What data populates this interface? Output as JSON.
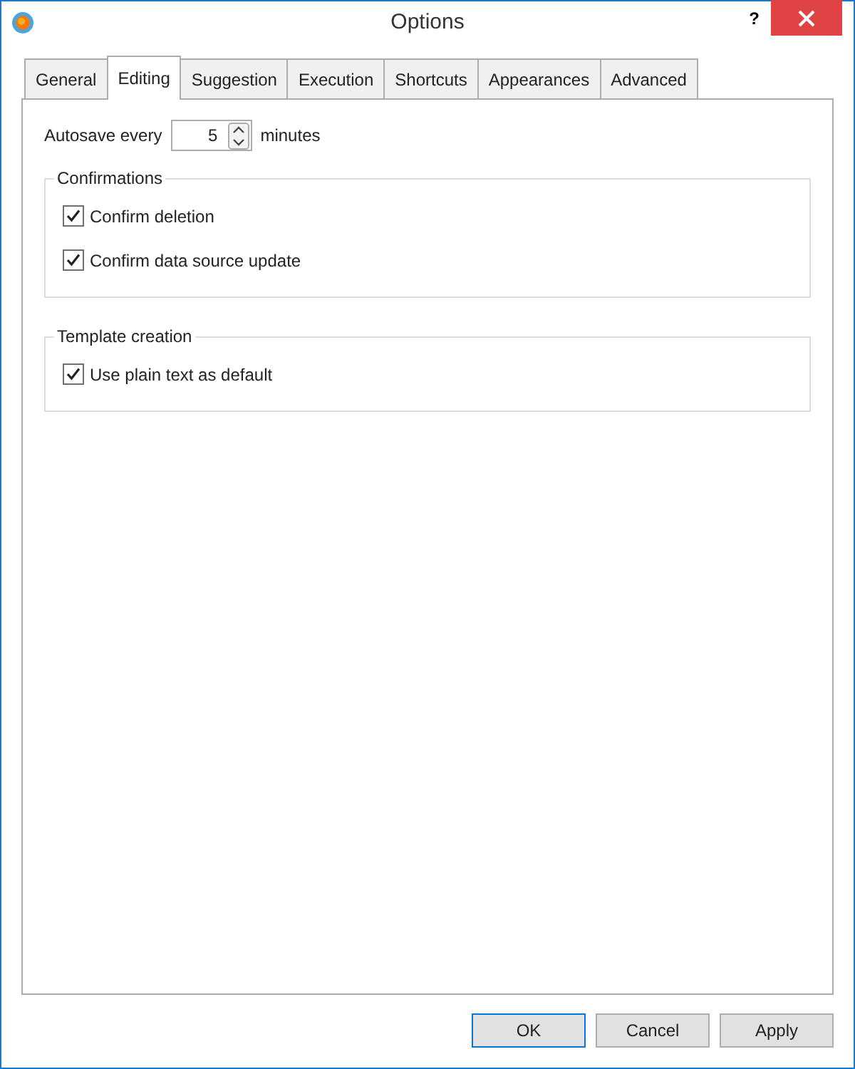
{
  "window": {
    "title": "Options",
    "help": "?"
  },
  "tabs": [
    {
      "label": "General",
      "selected": false
    },
    {
      "label": "Editing",
      "selected": true
    },
    {
      "label": "Suggestion",
      "selected": false
    },
    {
      "label": "Execution",
      "selected": false
    },
    {
      "label": "Shortcuts",
      "selected": false
    },
    {
      "label": "Appearances",
      "selected": false
    },
    {
      "label": "Advanced",
      "selected": false
    }
  ],
  "autosave": {
    "label": "Autosave every",
    "value": "5",
    "unit": "minutes"
  },
  "groups": [
    {
      "title": "Confirmations",
      "options": [
        {
          "label": "Confirm deletion",
          "checked": true
        },
        {
          "label": "Confirm data source update",
          "checked": true
        }
      ]
    },
    {
      "title": "Template creation",
      "options": [
        {
          "label": "Use plain text as default",
          "checked": true
        }
      ]
    }
  ],
  "buttons": [
    {
      "label": "OK",
      "default": true
    },
    {
      "label": "Cancel",
      "default": false
    },
    {
      "label": "Apply",
      "default": false
    }
  ]
}
